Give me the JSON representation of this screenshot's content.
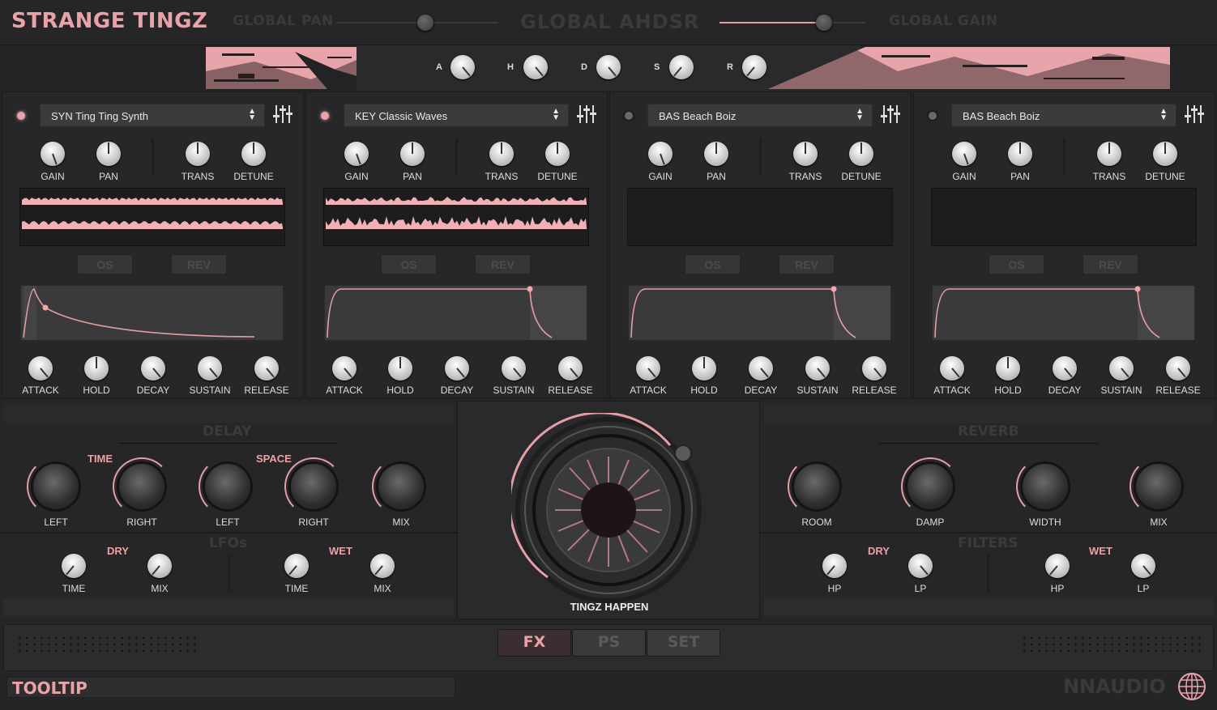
{
  "app": {
    "title": "STRANGE TINGZ",
    "vendor": "NNAUDIO"
  },
  "header": {
    "global_pan": "GLOBAL PAN",
    "global_ahdsr": "GLOBAL AHDSR",
    "global_gain": "GLOBAL GAIN",
    "pan_value": 0.5,
    "gain_value": 0.7
  },
  "ahdsr": {
    "a": "A",
    "h": "H",
    "d": "D",
    "s": "S",
    "r": "R"
  },
  "layers": [
    {
      "preset": "SYN Ting Ting Synth",
      "active": true
    },
    {
      "preset": "KEY Classic Waves",
      "active": true
    },
    {
      "preset": "BAS Beach Boiz",
      "active": false
    },
    {
      "preset": "BAS Beach Boiz",
      "active": false
    }
  ],
  "layer_labels": {
    "gain": "GAIN",
    "pan": "PAN",
    "trans": "TRANS",
    "detune": "DETUNE",
    "os": "OS",
    "rev": "REV",
    "attack": "ATTACK",
    "hold": "HOLD",
    "decay": "DECAY",
    "sustain": "SUSTAIN",
    "release": "RELEASE"
  },
  "delay": {
    "title": "DELAY",
    "time": "TIME",
    "space": "SPACE",
    "left": "LEFT",
    "right": "RIGHT",
    "mix": "MIX"
  },
  "lfos": {
    "title": "LFOs",
    "dry": "DRY",
    "wet": "WET",
    "time": "TIME",
    "mix": "MIX"
  },
  "reverb": {
    "title": "REVERB",
    "room": "ROOM",
    "damp": "DAMP",
    "width": "WIDTH",
    "mix": "MIX"
  },
  "filters": {
    "title": "FILTERS",
    "dry": "DRY",
    "wet": "WET",
    "hp": "HP",
    "lp": "LP"
  },
  "macro": {
    "label": "TINGZ HAPPEN"
  },
  "tabs": [
    "FX",
    "PS",
    "SET"
  ],
  "tooltip": "TOOLTIP",
  "colors": {
    "accent": "#e8a2a8",
    "background": "#242426"
  }
}
